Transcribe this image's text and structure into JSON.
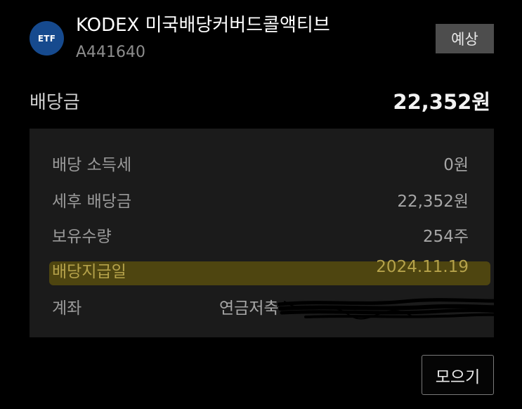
{
  "header": {
    "badge_text": "ETF",
    "fund_name": "KODEX 미국배당커버드콜액티브",
    "fund_code": "A441640",
    "forecast_label": "예상"
  },
  "dividend": {
    "label": "배당금",
    "amount": "22,352원"
  },
  "details": {
    "tax": {
      "label": "배당 소득세",
      "value": "0원"
    },
    "after_tax": {
      "label": "세후 배당금",
      "value": "22,352원"
    },
    "quantity": {
      "label": "보유수량",
      "value": "254주"
    },
    "payment_date": {
      "label": "배당지급일",
      "value": "2024.11.19"
    },
    "account": {
      "label": "계좌",
      "value": "연금저축"
    }
  },
  "collect_button_label": "모으기",
  "colors": {
    "background": "#000000",
    "etf_badge": "#164a8e",
    "panel": "#1b1b1b",
    "highlight": "#60540e"
  }
}
